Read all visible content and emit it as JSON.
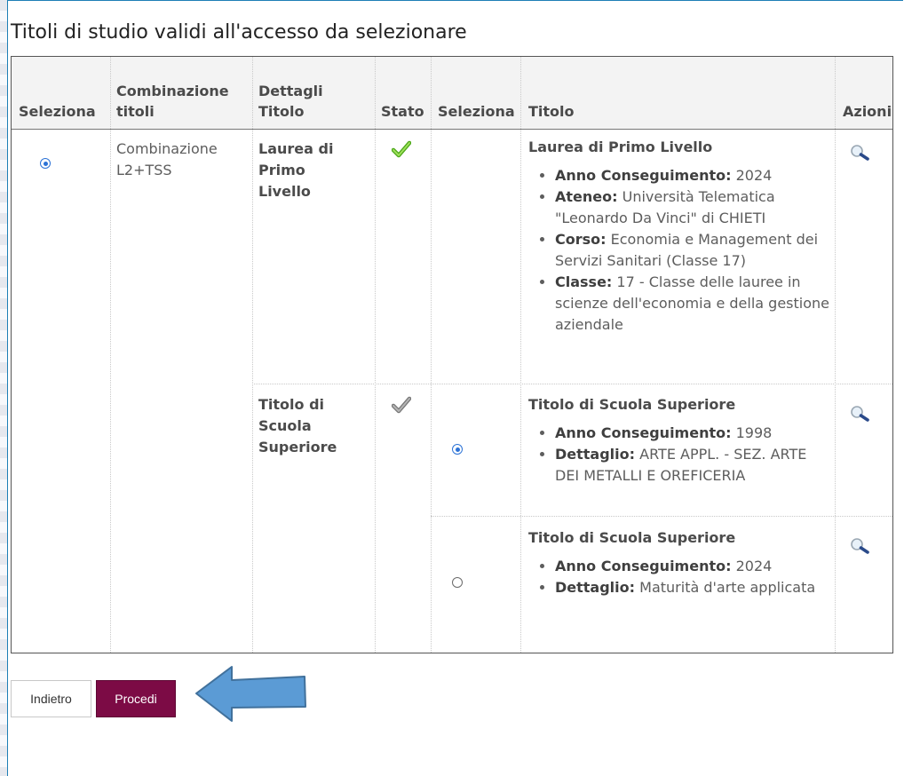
{
  "page": {
    "title": "Titoli di studio validi all'accesso da selezionare"
  },
  "table": {
    "headers": {
      "seleziona": "Seleziona",
      "combinazione_titoli": "Combinazione titoli",
      "dettagli_titolo": "Dettagli Titolo",
      "stato": "Stato",
      "seleziona2": "Seleziona",
      "titolo": "Titolo",
      "azioni": "Azioni"
    },
    "combination": {
      "selected": true,
      "name": "Combinazione L2+TSS"
    },
    "details": [
      {
        "label": "Laurea di Primo Livello",
        "status": "valid",
        "status_color": "#6ccc25"
      },
      {
        "label": "Titolo di Scuola Superiore",
        "status": "neutral",
        "status_color": "#8a8a8a"
      }
    ],
    "titles": [
      {
        "name": "Laurea di Primo Livello",
        "selected": null,
        "items": [
          {
            "k": "Anno Conseguimento:",
            "v": "2024"
          },
          {
            "k": "Ateneo:",
            "v": "Università Telematica \"Leonardo Da Vinci\" di CHIETI"
          },
          {
            "k": "Corso:",
            "v": "Economia e Management dei Servizi Sanitari (Classe 17)"
          },
          {
            "k": "Classe:",
            "v": "17 - Classe delle lauree in scienze dell'economia e della gestione aziendale"
          }
        ]
      },
      {
        "name": "Titolo di Scuola Superiore",
        "selected": true,
        "items": [
          {
            "k": "Anno Conseguimento:",
            "v": "1998"
          },
          {
            "k": "Dettaglio:",
            "v": "ARTE APPL. - SEZ. ARTE DEI METALLI E OREFICERIA"
          }
        ]
      },
      {
        "name": "Titolo di Scuola Superiore",
        "selected": false,
        "items": [
          {
            "k": "Anno Conseguimento:",
            "v": "2024"
          },
          {
            "k": "Dettaglio:",
            "v": "Maturità d'arte applicata"
          }
        ]
      }
    ]
  },
  "buttons": {
    "back": "Indietro",
    "next": "Procedi"
  },
  "colors": {
    "accent": "#7c0b45",
    "radio": "#2b72d6",
    "frame": "#1e7fb6",
    "arrow_fill": "#5b9bd5",
    "arrow_stroke": "#41719c"
  },
  "icons": {
    "row_action": "magnifier-icon",
    "status_valid": "green-check-icon",
    "status_other": "gray-check-icon"
  }
}
